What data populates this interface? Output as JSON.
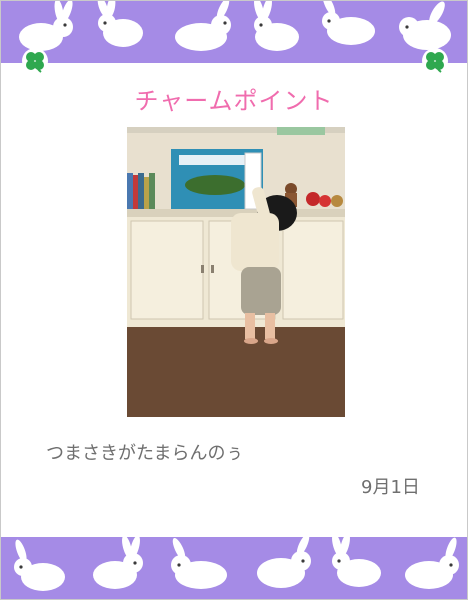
{
  "card": {
    "title": "チャームポイント",
    "caption": "つまさきがたまらんのぅ",
    "date": "9月1日"
  },
  "colors": {
    "band": "#a58be6",
    "title": "#f06cae",
    "text": "#6f6f6f",
    "clover": "#2fa84f"
  },
  "icons": {
    "band_pattern": "white-rabbit-silhouettes",
    "corner": "four-leaf-clover"
  }
}
